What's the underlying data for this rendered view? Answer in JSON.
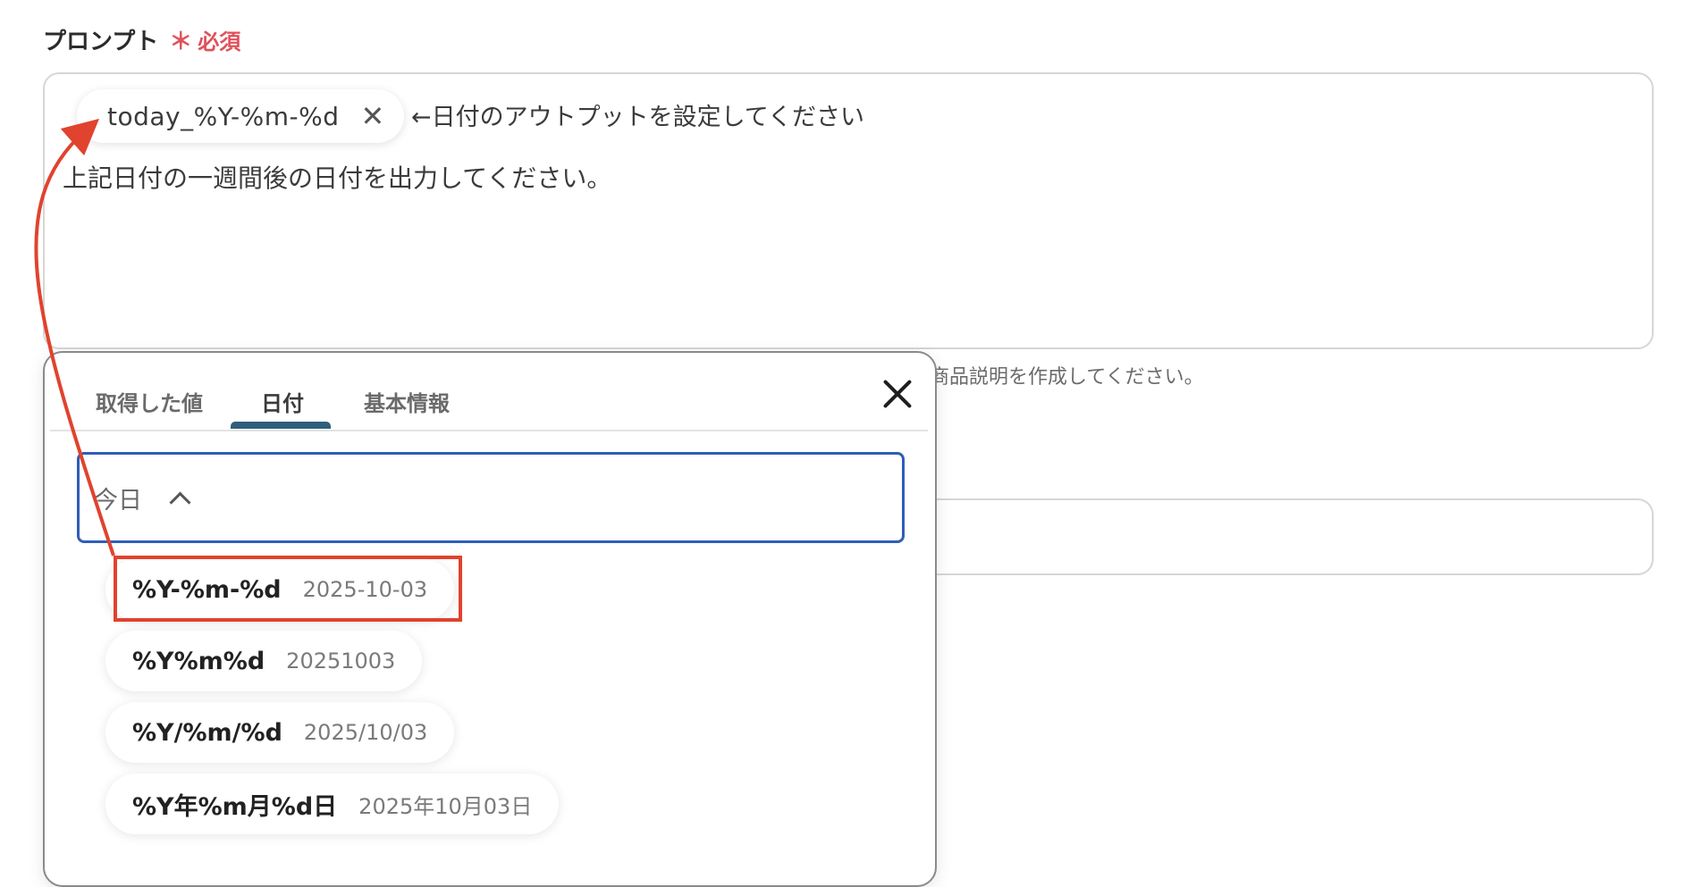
{
  "field": {
    "label": "プロンプト",
    "required_mark": "＊",
    "required_text": "必須"
  },
  "prompt": {
    "chip_value": "today_%Y-%m-%d",
    "chip_remove_icon": "close-icon",
    "note": "←日付のアウトプットを設定してください",
    "body": "上記日付の一週間後の日付を出力してください。"
  },
  "hint": "商品説明を作成してください。",
  "popup": {
    "tabs": [
      {
        "label": "取得した値"
      },
      {
        "label": "日付",
        "active": true
      },
      {
        "label": "基本情報"
      }
    ],
    "close_icon": "close-icon",
    "select": {
      "value": "今日",
      "icon": "chevron-up-icon"
    },
    "options": [
      {
        "format": "%Y-%m-%d",
        "example": "2025-10-03"
      },
      {
        "format": "%Y%m%d",
        "example": "20251003"
      },
      {
        "format": "%Y/%m/%d",
        "example": "2025/10/03"
      },
      {
        "format": "%Y年%m月%d日",
        "example": "2025年10月03日"
      }
    ]
  },
  "colors": {
    "required": "#e0515a",
    "tab_indicator": "#2f5f7b",
    "select_border": "#2f5db8",
    "annotation": "#e0432e"
  }
}
